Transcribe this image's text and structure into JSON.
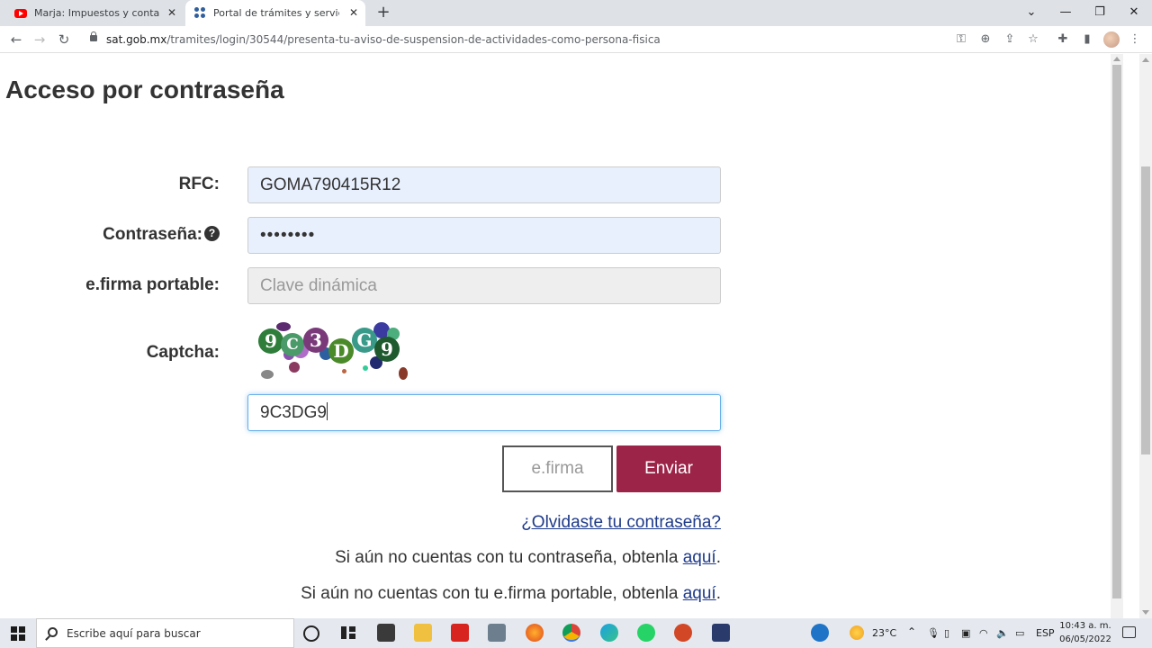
{
  "browser": {
    "tabs": [
      {
        "title": "Marja: Impuestos y contabilidad",
        "favicon": "youtube-icon",
        "active": false
      },
      {
        "title": "Portal de trámites y servicios - SAT",
        "favicon": "sat-icon",
        "active": true
      }
    ],
    "url_domain": "sat.gob.mx",
    "url_path": "/tramites/login/30544/presenta-tu-aviso-de-suspension-de-actividades-como-persona-fisica"
  },
  "page": {
    "title": "Acceso por contraseña",
    "form": {
      "rfc_label": "RFC:",
      "rfc_value": "GOMA790415R12",
      "password_label": "Contraseña:",
      "password_value": "••••••••",
      "efirma_label": "e.firma portable:",
      "efirma_placeholder": "Clave dinámica",
      "captcha_label": "Captcha:",
      "captcha_value": "9C3DG9"
    },
    "buttons": {
      "efirma": "e.firma",
      "enviar": "Enviar"
    },
    "links": {
      "forgot": "¿Olvidaste tu contraseña?",
      "no_password_text": "Si aún no cuentas con tu contraseña, obtenla ",
      "no_password_link": "aquí",
      "no_efirma_text": "Si aún no cuentas con tu e.firma portable, obtenla ",
      "no_efirma_link": "aquí"
    },
    "colors": {
      "primary": "#9d2449",
      "link": "#1e3a8a"
    }
  },
  "taskbar": {
    "search_placeholder": "Escribe aquí para buscar",
    "weather": "23°C",
    "language": "ESP",
    "time": "10:43 a. m.",
    "date": "06/05/2022"
  }
}
